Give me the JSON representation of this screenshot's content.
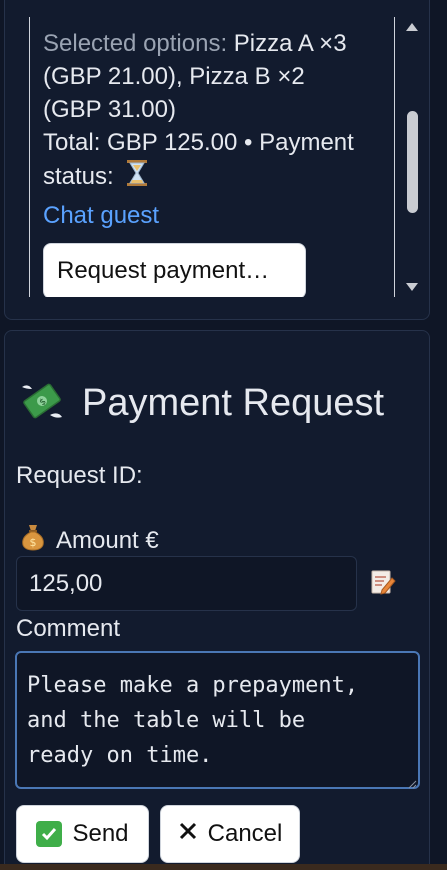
{
  "order": {
    "selected_label": "Selected options:",
    "selected_value_line1": "Pizza A ×3",
    "selected_value_line2": "(GBP 21.00), Pizza B ×2",
    "selected_value_line3": "(GBP 31.00)",
    "total_line1": "Total: GBP 125.00 • Payment",
    "status_label": "status:",
    "status_icon": "hourglass-icon",
    "chat_link": "Chat guest",
    "request_payment_button": "Request payment…"
  },
  "payment_request": {
    "title": "Payment Request",
    "title_icon": "money-with-wings-icon",
    "request_id_label": "Request ID:",
    "request_id_value": "",
    "amount_icon": "money-bag-icon",
    "amount_label": "Amount €",
    "amount_value": "125,00",
    "comment_label": "Comment",
    "comment_value": "Please make a prepayment,\nand the table will be\nready on time.",
    "send_button": "Send",
    "cancel_button": "Cancel"
  },
  "colors": {
    "background": "#0f1626",
    "card": "#121b2e",
    "link": "#5aa2ff",
    "focus_border": "#4a77b5",
    "send_icon_green": "#3fae49"
  }
}
